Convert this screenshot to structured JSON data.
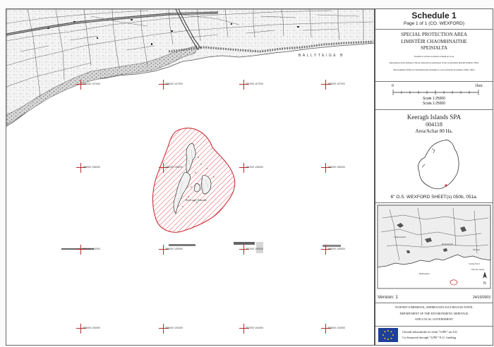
{
  "legend": {
    "schedule_title": "Schedule 1",
    "page_info": "Page 1 of 1 (CO. WEXFORD)",
    "spa_en": "SPECIAL PROTECTION AREA",
    "spa_ga_1": "LIMISTÉIR CHAOMHNAITHE",
    "spa_ga_2": "SPEISIALTA",
    "note_1": "Tuairim ar an líne is tuairim a bheith nó sé an",
    "note_2": "Reproduced from Ordnance Survey material by permission of the Government (Permit Number 7661)",
    "note_3": "Macasamhail d'ábhar na Suirbhéireachta Ordanáis le cead ón Rialtas (Ceadúnas Uimh. 7661)",
    "scale": {
      "start": "0",
      "end": "1km",
      "scale_1": "Scale 1:25000",
      "scale_2": "Scala 1:25000"
    },
    "site_name": "Keeragh Islands SPA",
    "site_code": "004118",
    "area": "Area/Achar 80 Ha.",
    "sheets": "6\" O.S.  WEXFORD   SHEET(s) 050b, 051a.",
    "version": "Version: 1",
    "date": "24/10/2003",
    "dept_1": "AN ROINN COMHSHAOIL, OIDHREACHTA AGUS RIALTAIS ÁITIÚIL",
    "dept_2": "DEPARTMENT OF THE ENVIRONMENT, HERITAGE",
    "dept_3": "AND LOCAL GOVERNMENT",
    "funding_1": "Chomh-mhaoinithe trí chlár \"LIFE\" an A.E.",
    "funding_2": "Co-financed through \"LIFE\" E.U. funding"
  },
  "map": {
    "town_label": "BALLYTEIGE B",
    "island_label": "Keeragh Islands",
    "grid_labels": [
      "295000 107000",
      "296000 107000",
      "297000 107000",
      "298000 107000",
      "295000 106000",
      "296000 106000",
      "297000 106000",
      "298000 106000",
      "295000 105000",
      "296000 105000",
      "297000 105000",
      "298000 105000",
      "295000 104000",
      "296000 104000",
      "297000 104000",
      "298000 104000"
    ]
  },
  "inset": {
    "places": [
      "Rathangan",
      "Cleariestown",
      "Duncormick",
      "Kilmore",
      "Carrig Point",
      "Kilmore Quay"
    ]
  },
  "colors": {
    "spa_boundary": "#c8323a",
    "map_line": "#444444",
    "grid_cross": "#b52a2a",
    "eu_flag": "#1e3f9a",
    "eu_stars": "#f4d000"
  }
}
